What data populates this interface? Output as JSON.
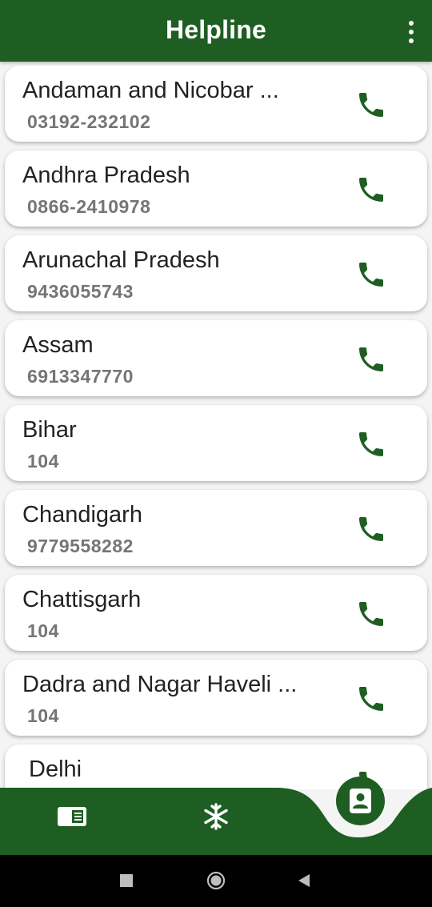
{
  "header": {
    "title": "Helpline",
    "menu_icon": "more-vert-icon"
  },
  "colors": {
    "primary": "#1e5e22",
    "background": "#f4f4f4",
    "card": "#ffffff",
    "number_text": "#757575"
  },
  "helplines": [
    {
      "name": "Andaman and Nicobar ...",
      "number": "03192-232102"
    },
    {
      "name": "Andhra Pradesh",
      "number": "0866-2410978"
    },
    {
      "name": "Arunachal Pradesh",
      "number": "9436055743"
    },
    {
      "name": "Assam",
      "number": "6913347770"
    },
    {
      "name": "Bihar",
      "number": "104"
    },
    {
      "name": "Chandigarh",
      "number": "9779558282"
    },
    {
      "name": "Chattisgarh",
      "number": "104"
    },
    {
      "name": "Dadra and Nagar Haveli ...",
      "number": "104"
    },
    {
      "name": "Delhi",
      "number": ""
    }
  ],
  "bottom_nav": {
    "items": [
      {
        "icon": "news-icon"
      },
      {
        "icon": "virus-icon"
      },
      {
        "icon": "contact-card-icon",
        "active": true
      }
    ]
  },
  "system_nav": {
    "buttons": [
      "recents-square-icon",
      "home-circle-icon",
      "back-triangle-icon"
    ]
  }
}
